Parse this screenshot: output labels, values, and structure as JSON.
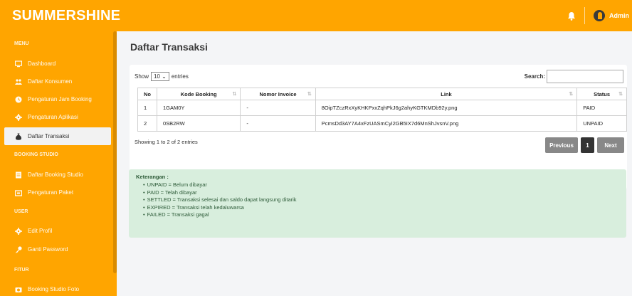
{
  "brand": "SUMMERSHINE",
  "header": {
    "user": "Admin",
    "bell_icon": "bell-icon",
    "avatar_icon": "user-avatar-icon"
  },
  "sidebar": {
    "sections": [
      {
        "title": "MENU",
        "items": [
          {
            "label": "Dashboard",
            "icon": "monitor-icon"
          },
          {
            "label": "Daftar Konsumen",
            "icon": "users-icon"
          },
          {
            "label": "Pengaturan Jam Booking",
            "icon": "clock-icon"
          },
          {
            "label": "Pengaturan Aplikasi",
            "icon": "gear-icon"
          },
          {
            "label": "Daftar Transaksi",
            "icon": "money-bag-icon",
            "active": true
          }
        ]
      },
      {
        "title": "BOOKING STUDIO",
        "items": [
          {
            "label": "Daftar Booking Studio",
            "icon": "list-icon"
          },
          {
            "label": "Pengaturan Paket",
            "icon": "package-icon"
          }
        ]
      },
      {
        "title": "USER",
        "items": [
          {
            "label": "Edit Profil",
            "icon": "gear-icon"
          },
          {
            "label": "Ganti Password",
            "icon": "key-icon"
          }
        ]
      },
      {
        "title": "FITUR",
        "items": [
          {
            "label": "Booking Studio Foto",
            "icon": "camera-icon"
          }
        ]
      }
    ]
  },
  "page": {
    "title": "Daftar Transaksi"
  },
  "table_controls": {
    "show_label": "Show",
    "entries_value": "10",
    "entries_label": "entries",
    "search_label": "Search:"
  },
  "table": {
    "columns": [
      "No",
      "Kode Booking",
      "Nomor Invoice",
      "Link",
      "Status"
    ],
    "rows": [
      [
        "1",
        "1GAM0Y",
        "-",
        "8OipTZczRxXyKHKPxxZqhPkJ6g2ahyKGTKMDb92y.png",
        "PAID"
      ],
      [
        "2",
        "0SB2RW",
        "-",
        "PcmsDd3AY7A4xFzUASmCyi2GB5IX7d6MnShJvsnV.png",
        "UNPAID"
      ]
    ]
  },
  "table_info": "Showing 1 to 2 of 2 entries",
  "pagination": {
    "previous": "Previous",
    "current": "1",
    "next": "Next"
  },
  "keterangan": {
    "title": "Keterangan :",
    "items": [
      "UNPAID = Belum dibayar",
      "PAID = Telah dibayar",
      "SETTLED = Transaksi selesai dan saldo dapat langsung ditarik",
      "EXPIRED = Transaksi telah kedaluwarsa",
      "FAILED = Transaksi gagal"
    ]
  },
  "colors": {
    "accent": "#ffa500",
    "note_bg": "#d8eedd",
    "note_text": "#2c5a37"
  }
}
